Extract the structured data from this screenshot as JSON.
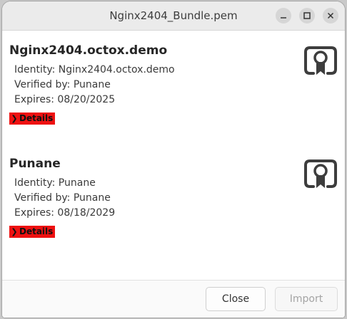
{
  "window": {
    "title": "Nginx2404_Bundle.pem"
  },
  "certificates": [
    {
      "name": "Nginx2404.octox.demo",
      "identity": "Identity: Nginx2404.octox.demo",
      "verified_by": "Verified by: Punane",
      "expires": "Expires: 08/20/2025",
      "details_label": "Details",
      "icon": "certificate-icon"
    },
    {
      "name": "Punane",
      "identity": "Identity: Punane",
      "verified_by": "Verified by: Punane",
      "expires": "Expires: 08/18/2029",
      "details_label": "Details",
      "icon": "certificate-icon"
    }
  ],
  "footer": {
    "close_label": "Close",
    "import_label": "Import"
  },
  "colors": {
    "details_highlight": "#ee1111",
    "titlebar": "#ebebeb",
    "icon": "#3d3d3d"
  }
}
